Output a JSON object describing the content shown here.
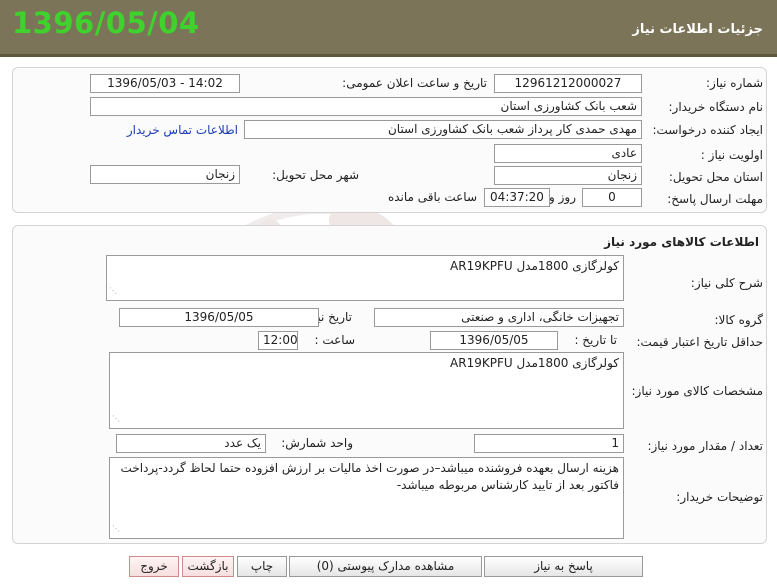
{
  "header": {
    "title": "جزئیات اطلاعات نیاز",
    "date": "1396/05/04"
  },
  "need_info": {
    "need_number_label": "شماره نیاز:",
    "need_number": "12961212000027",
    "announce_label": "تاریخ و ساعت اعلان عمومی:",
    "announce_value": "1396/05/03 - 14:02",
    "buyer_org_label": "نام دستگاه خریدار:",
    "buyer_org": "شعب بانک کشاورزی استان",
    "creator_label": "ایجاد کننده درخواست:",
    "creator": "مهدی حمدی  کار پرداز شعب بانک کشاورزی استان",
    "contact_link": "اطلاعات تماس خریدار",
    "priority_label": "اولویت نیاز :",
    "priority": "عادی",
    "province_label": "استان محل تحویل:",
    "province": "زنجان",
    "city_label": "شهر محل تحویل:",
    "city": "زنجان",
    "deadline_label": "مهلت ارسال پاسخ:",
    "days": "0",
    "day_and": "روز و",
    "time_left": "04:37:20",
    "remaining": "ساعت باقی مانده"
  },
  "goods": {
    "section_title": "اطلاعات کالاهای مورد نیاز",
    "general_desc_label": "شرح کلی نیاز:",
    "general_desc": "کولرگازی 1800مدل AR19KPFU",
    "group_label": "گروه کالا:",
    "group": "تجهیزات خانگی، اداری و صنعتی",
    "need_date_label": "تاریخ نیاز به کالا:",
    "need_date": "1396/05/05",
    "min_validity_label": "حداقل تاریخ اعتبار قیمت:",
    "until_label": "تا تاریخ :",
    "validity_date": "1396/05/05",
    "hour_label": "ساعت :",
    "validity_hour": "12:00",
    "specs_label": "مشخصات کالای مورد نیاز:",
    "specs": "کولرگازی 1800مدل AR19KPFU",
    "qty_label": "تعداد / مقدار مورد نیاز:",
    "qty": "1",
    "unit_label": "واحد شمارش:",
    "unit": "یک عدد",
    "buyer_notes_label": "توضیحات خریدار:",
    "buyer_notes": "هزینه ارسال بعهده فروشنده میباشد–در صورت اخذ مالیات بر ارزش افزوده حتما لحاظ گردد-پرداخت فاکتور بعد از تایید کارشناس مربوطه میباشد-"
  },
  "actions": {
    "reply": "پاسخ به نیاز",
    "attachments": "مشاهده مدارک پیوستی (0)",
    "print": "چاپ",
    "back": "بازگشت",
    "exit": "خروج"
  },
  "colors": {
    "titlebar": "#7b7458",
    "date_green": "#3fd22c",
    "link_blue": "#1a3db5"
  }
}
